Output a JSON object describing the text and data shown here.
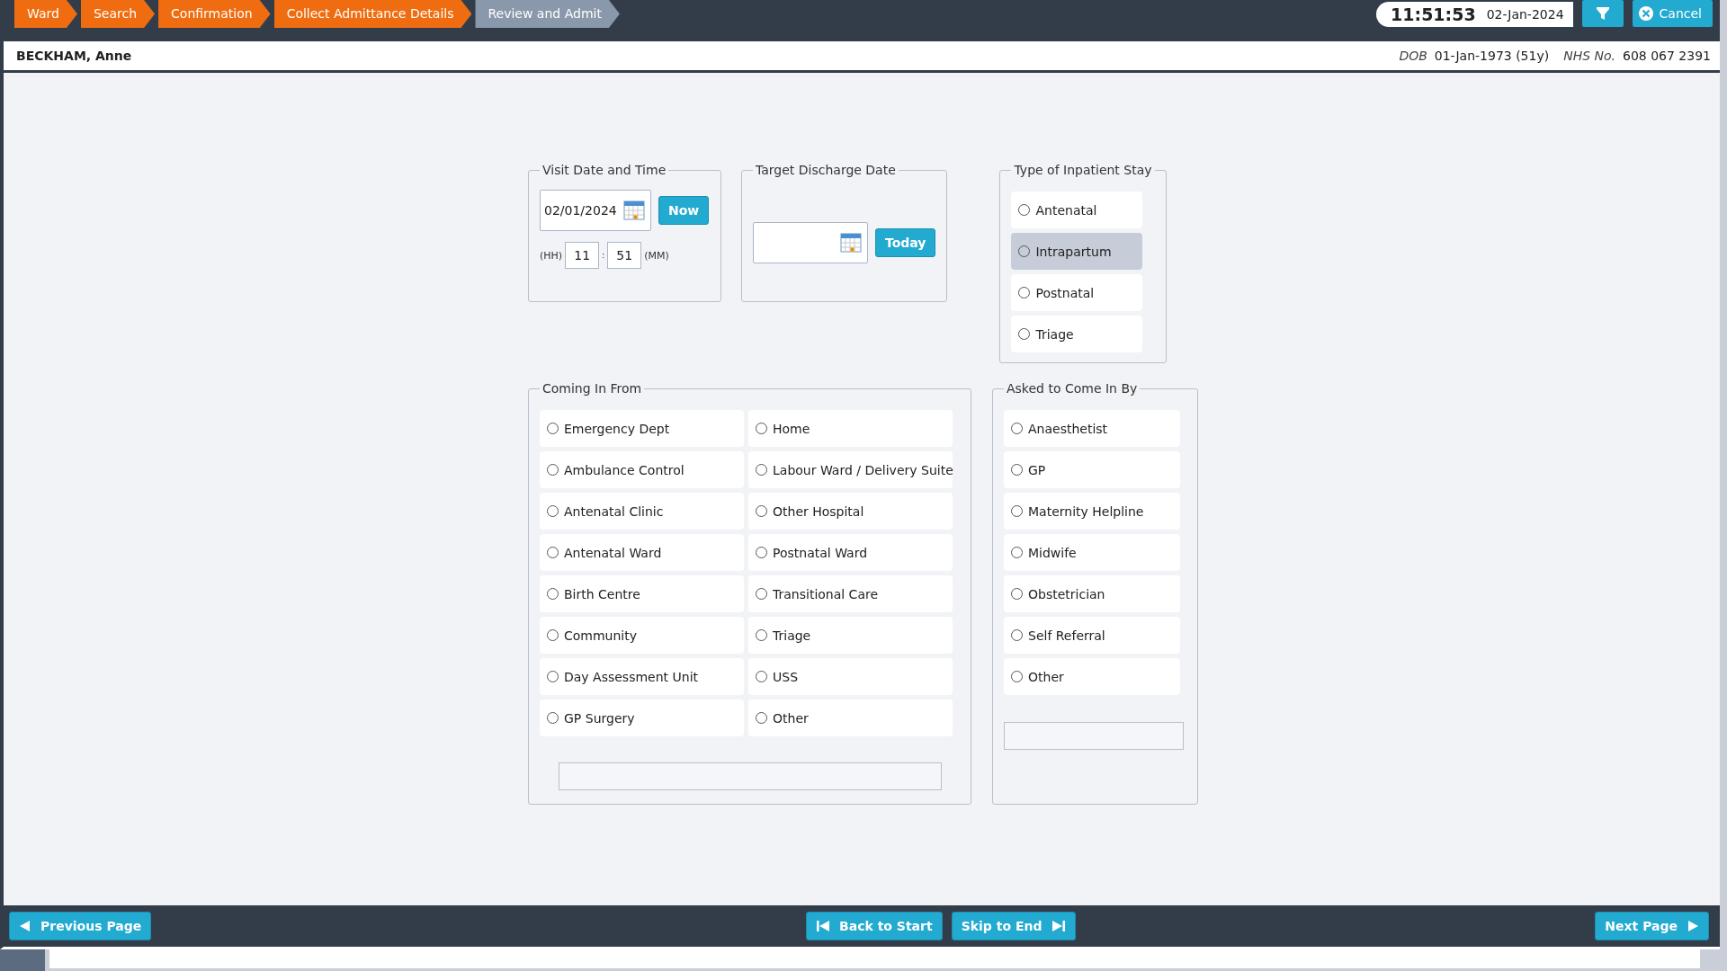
{
  "breadcrumbs": [
    {
      "label": "Ward",
      "done": true
    },
    {
      "label": "Search",
      "done": true
    },
    {
      "label": "Confirmation",
      "done": true
    },
    {
      "label": "Collect Admittance Details",
      "done": true
    },
    {
      "label": "Review and Admit",
      "done": false
    }
  ],
  "clock": {
    "time": "11:51:53",
    "date": "02-Jan-2024"
  },
  "cancel_button": "Cancel",
  "patient": {
    "name": "BECKHAM, Anne",
    "dob_label": "DOB",
    "dob": "01-Jan-1973 (51y)",
    "nhs_label": "NHS No.",
    "nhs": "608 067 2391"
  },
  "visit": {
    "legend": "Visit Date and Time",
    "date": "02/01/2024",
    "now_button": "Now",
    "hh_label": "(HH)",
    "hour": "11",
    "separator": ":",
    "minute": "51",
    "mm_label": "(MM)"
  },
  "discharge": {
    "legend": "Target Discharge Date",
    "today_button": "Today"
  },
  "stay": {
    "legend": "Type of Inpatient Stay",
    "options": [
      {
        "label": "Antenatal",
        "selected": false,
        "highlighted": false
      },
      {
        "label": "Intrapartum",
        "selected": false,
        "highlighted": true
      },
      {
        "label": "Postnatal",
        "selected": false,
        "highlighted": false
      },
      {
        "label": "Triage",
        "selected": false,
        "highlighted": false
      }
    ]
  },
  "coming_in_from": {
    "legend": "Coming In From",
    "options": [
      {
        "label": "Emergency Dept",
        "selected": false
      },
      {
        "label": "Home",
        "selected": false
      },
      {
        "label": "Ambulance Control",
        "selected": false
      },
      {
        "label": "Labour Ward / Delivery Suite",
        "selected": false
      },
      {
        "label": "Antenatal Clinic",
        "selected": false
      },
      {
        "label": "Other Hospital",
        "selected": false
      },
      {
        "label": "Antenatal Ward",
        "selected": false
      },
      {
        "label": "Postnatal Ward",
        "selected": false
      },
      {
        "label": "Birth Centre",
        "selected": false
      },
      {
        "label": "Transitional Care",
        "selected": false
      },
      {
        "label": "Community",
        "selected": false
      },
      {
        "label": "Triage",
        "selected": false
      },
      {
        "label": "Day Assessment Unit",
        "selected": false
      },
      {
        "label": "USS",
        "selected": false
      },
      {
        "label": "GP Surgery",
        "selected": false
      },
      {
        "label": "Other",
        "selected": false
      }
    ]
  },
  "asked_to_come_in_by": {
    "legend": "Asked to Come In By",
    "options": [
      {
        "label": "Anaesthetist",
        "selected": false
      },
      {
        "label": "GP",
        "selected": false
      },
      {
        "label": "Maternity Helpline",
        "selected": false
      },
      {
        "label": "Midwife",
        "selected": false
      },
      {
        "label": "Obstetrician",
        "selected": false
      },
      {
        "label": "Self Referral",
        "selected": false
      },
      {
        "label": "Other",
        "selected": false
      }
    ]
  },
  "footer": {
    "previous": "Previous Page",
    "back_to_start": "Back to Start",
    "skip_to_end": "Skip to End",
    "next": "Next Page"
  }
}
